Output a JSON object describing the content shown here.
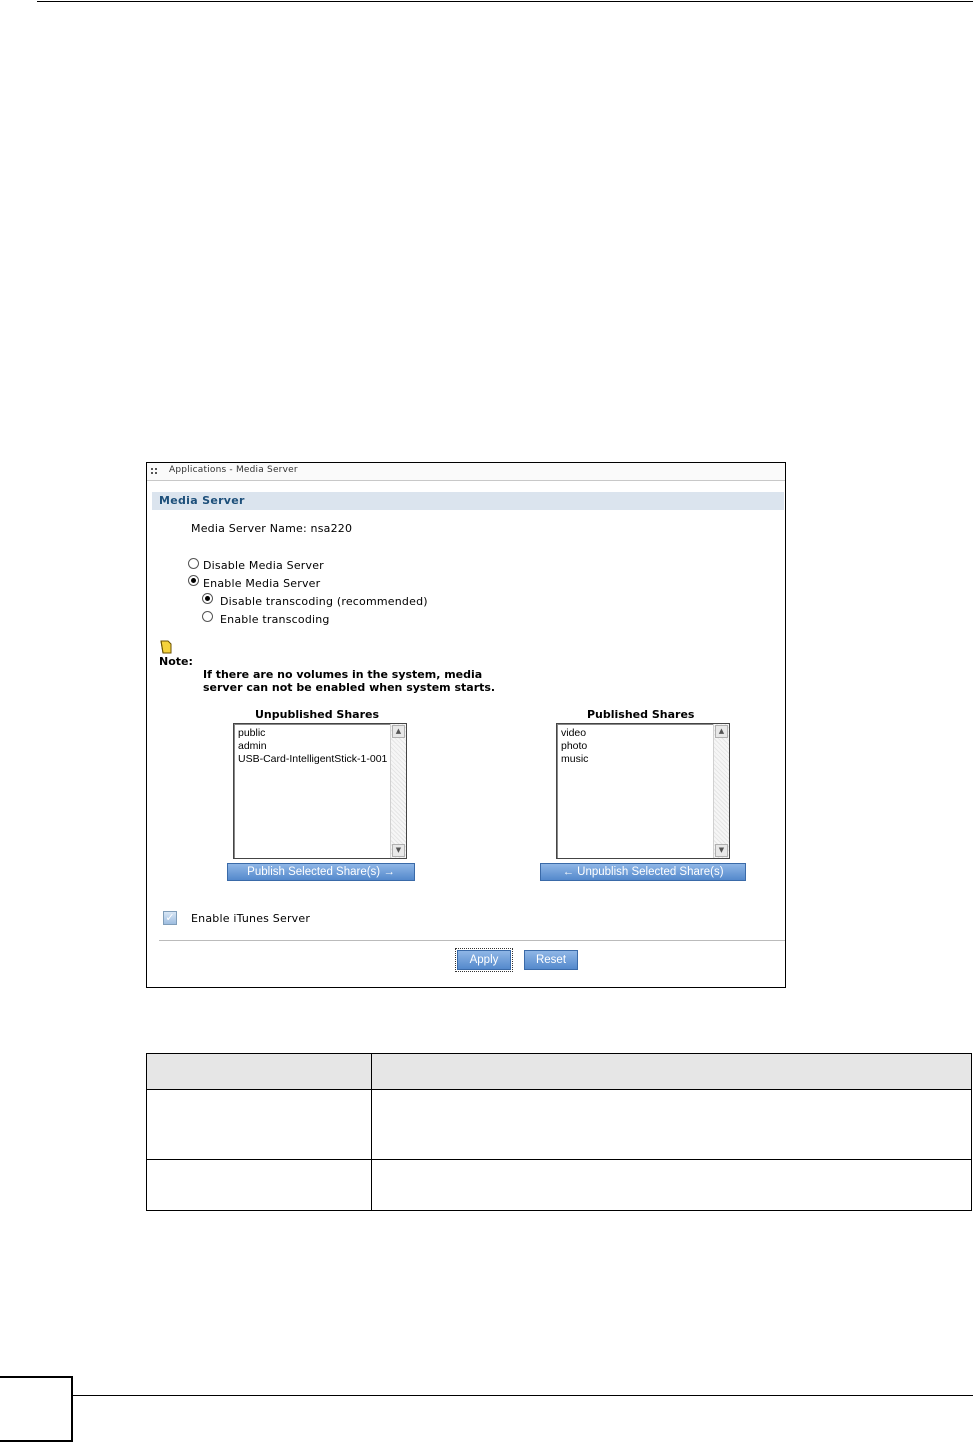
{
  "window": {
    "title": "Applications - Media Server"
  },
  "section": {
    "title": "Media Server"
  },
  "server_name": {
    "label": "Media Server Name: nsa220"
  },
  "options": {
    "disable_server": "Disable Media Server",
    "enable_server": "Enable Media Server",
    "disable_transcoding": "Disable transcoding (recommended)",
    "enable_transcoding": "Enable transcoding",
    "selected_server_option": "Enable Media Server",
    "selected_transcoding_option": "Disable transcoding (recommended)"
  },
  "note": {
    "label": "Note:",
    "line1": "If there are no volumes in the system, media",
    "line2": "server can not be enabled when system starts."
  },
  "unpublished": {
    "title": "Unpublished Shares",
    "items": [
      "public",
      "admin",
      "USB-Card-IntelligentStick-1-001"
    ],
    "button": "Publish Selected Share(s) →"
  },
  "published": {
    "title": "Published Shares",
    "items": [
      "video",
      "photo",
      "music"
    ],
    "button": "← Unpublish Selected Share(s)"
  },
  "itunes": {
    "label": "Enable iTunes Server",
    "checked": true
  },
  "actions": {
    "apply": "Apply",
    "reset": "Reset"
  },
  "icons": {
    "window_grip": "grip-icon",
    "note": "note-icon",
    "scroll_up": "scroll-up-icon",
    "scroll_down": "scroll-down-icon",
    "checkmark": "checkmark-icon"
  }
}
